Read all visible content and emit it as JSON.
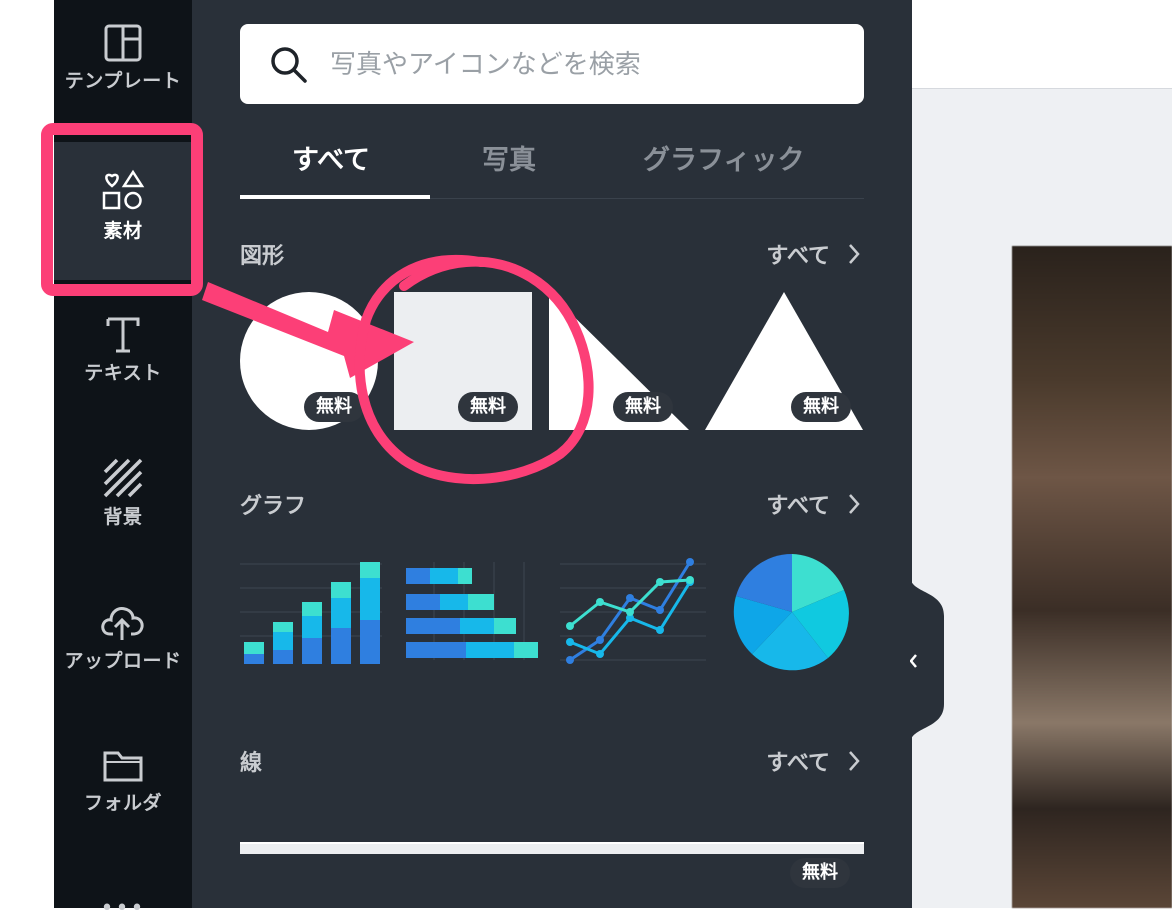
{
  "nav": {
    "items": [
      {
        "label": "テンプレート",
        "icon": "template-icon"
      },
      {
        "label": "素材",
        "icon": "elements-icon",
        "active": true
      },
      {
        "label": "テキスト",
        "icon": "text-icon"
      },
      {
        "label": "背景",
        "icon": "background-icon"
      },
      {
        "label": "アップロード",
        "icon": "upload-cloud-icon"
      },
      {
        "label": "フォルダ",
        "icon": "folder-icon"
      }
    ],
    "more": "•••"
  },
  "search": {
    "placeholder": "写真やアイコンなどを検索"
  },
  "tabs": [
    {
      "label": "すべて",
      "active": true
    },
    {
      "label": "写真"
    },
    {
      "label": "グラフィック"
    }
  ],
  "sections": {
    "shapes": {
      "title": "図形",
      "see_all": "すべて"
    },
    "charts": {
      "title": "グラフ",
      "see_all": "すべて"
    },
    "lines": {
      "title": "線",
      "see_all": "すべて"
    }
  },
  "badges": {
    "free": "無料"
  },
  "colors": {
    "nav_bg": "#0e1318",
    "panel_bg": "#293039",
    "annotation": "#fc3f77",
    "chart_blue": "#2f7fe0",
    "chart_teal": "#3ddfd0",
    "chart_cyan": "#17b8ea"
  }
}
